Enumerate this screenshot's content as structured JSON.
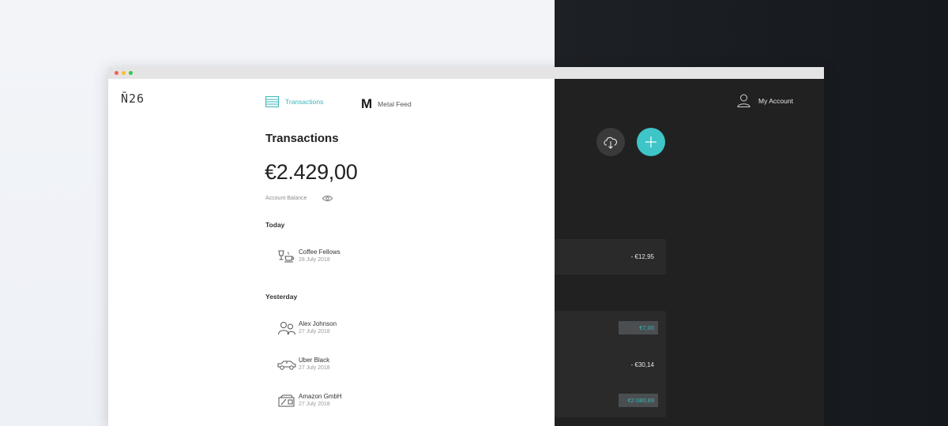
{
  "app": {
    "logo": "N̄26"
  },
  "nav": {
    "transactions": "Transactions",
    "metal_feed_mark": "M",
    "metal_feed": "Metal Feed",
    "account": "My Account"
  },
  "main": {
    "title": "Transactions",
    "balance": "€2.429,00",
    "balance_label": "Account Balance"
  },
  "sections": [
    {
      "label": "Today",
      "items": [
        {
          "name": "Coffee Fellows",
          "date": "28 July 2018",
          "amount": "- €12,95",
          "icon": "coffee-icon",
          "credit": false
        }
      ]
    },
    {
      "label": "Yesterday",
      "items": [
        {
          "name": "Alex Johnson",
          "date": "27 July 2018",
          "amount": "€7,00",
          "icon": "people-icon",
          "credit": true
        },
        {
          "name": "Uber Black",
          "date": "27 July 2018",
          "amount": "- €30,14",
          "icon": "car-icon",
          "credit": false
        },
        {
          "name": "Amazon GmbH",
          "date": "27 July 2018",
          "amount": "€2.080,89",
          "icon": "wallet-icon",
          "credit": true
        }
      ]
    }
  ],
  "colors": {
    "accent": "#3ec5c8",
    "dark": "#212121",
    "text": "#222222"
  }
}
